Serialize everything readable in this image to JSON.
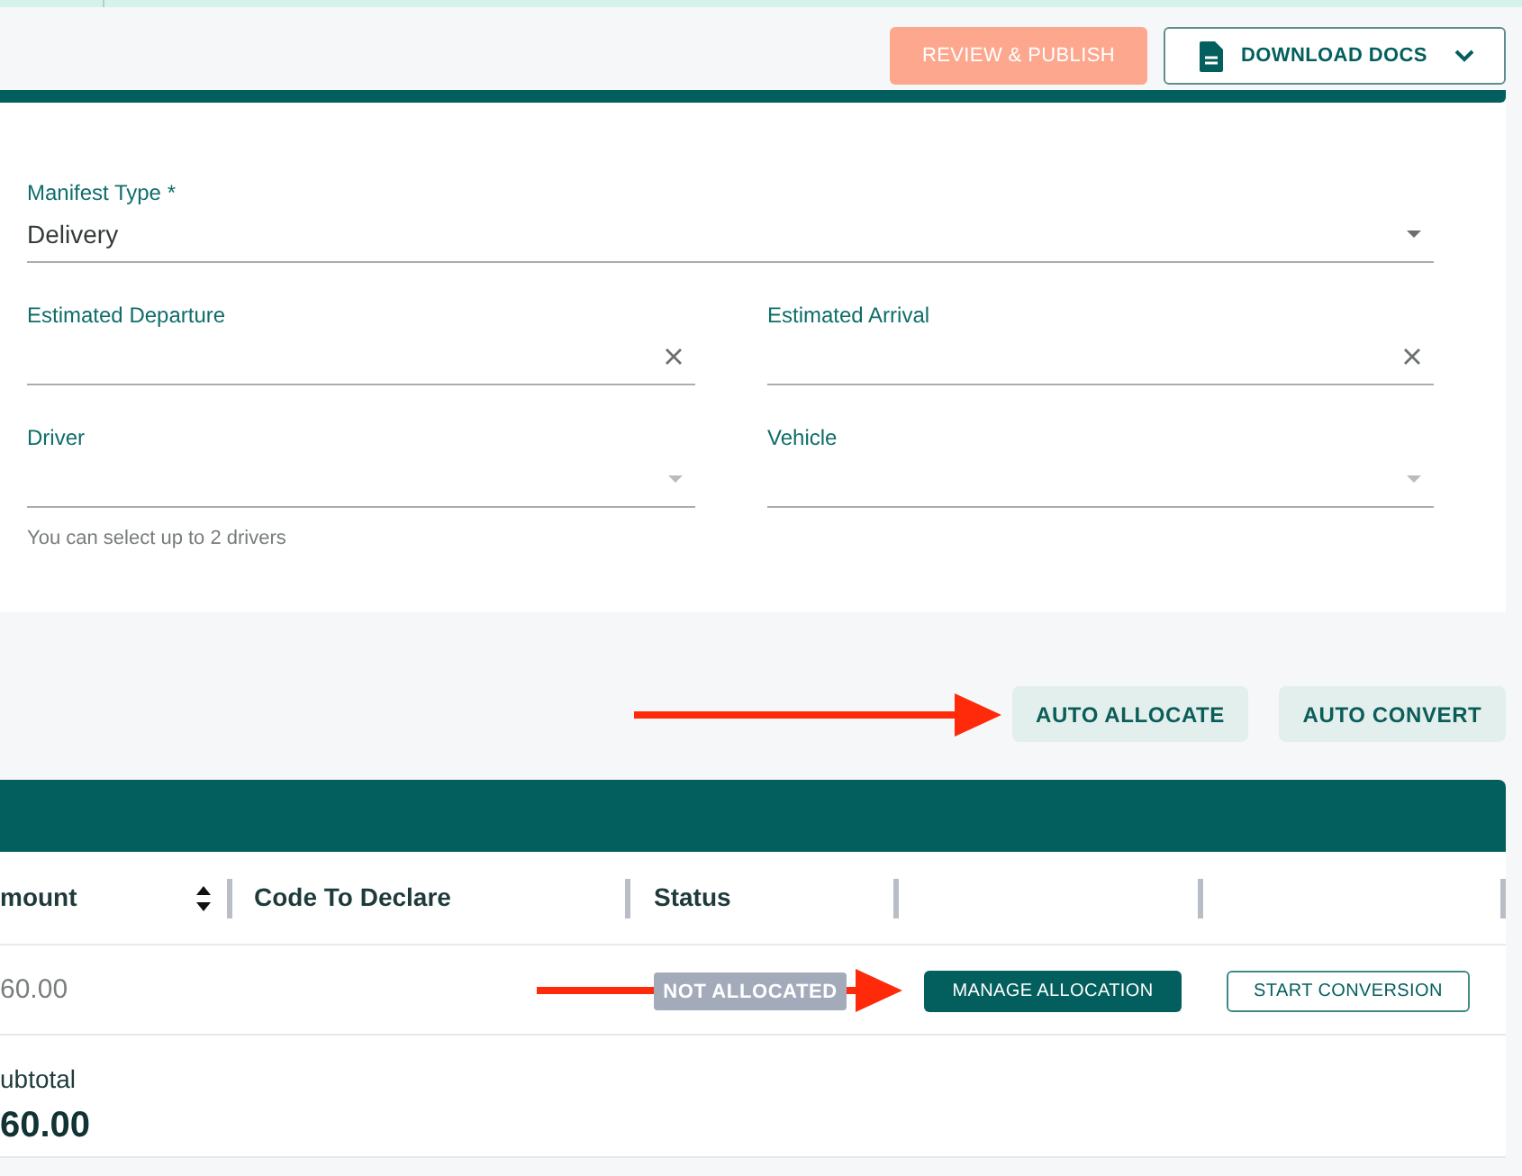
{
  "header": {
    "buttons": [
      {
        "label": "REVIEW & PUBLISH",
        "kind": "action",
        "disabled": true
      },
      {
        "label": "DOWNLOAD DOCS",
        "kind": "dropdown",
        "disabled": false
      }
    ]
  },
  "form": {
    "fields": [
      {
        "label": "Manifest Type *",
        "kind": "select",
        "value": "Delivery",
        "wide": true
      },
      {
        "label": "Estimated Departure",
        "kind": "date"
      },
      {
        "label": "Estimated Arrival",
        "kind": "date"
      },
      {
        "label": "Driver",
        "kind": "select",
        "helper": "You can select up to 2 drivers"
      },
      {
        "label": "Vehicle",
        "kind": "select"
      }
    ]
  },
  "actions": [
    "AUTO ALLOCATE",
    "AUTO CONVERT"
  ],
  "table": {
    "columns": [
      {
        "label": "mount",
        "sortable": true
      },
      {
        "label": "Code To Declare"
      },
      {
        "label": "Status"
      },
      {},
      {}
    ],
    "rows": [
      {
        "amount": "60.00",
        "status": "NOT ALLOCATED",
        "actions": [
          {
            "label": "MANAGE ALLOCATION",
            "kind": "primary"
          },
          {
            "label": "START CONVERSION",
            "kind": "outline"
          }
        ]
      }
    ],
    "subtotal": {
      "label": "ubtotal",
      "value": "60.00"
    }
  }
}
